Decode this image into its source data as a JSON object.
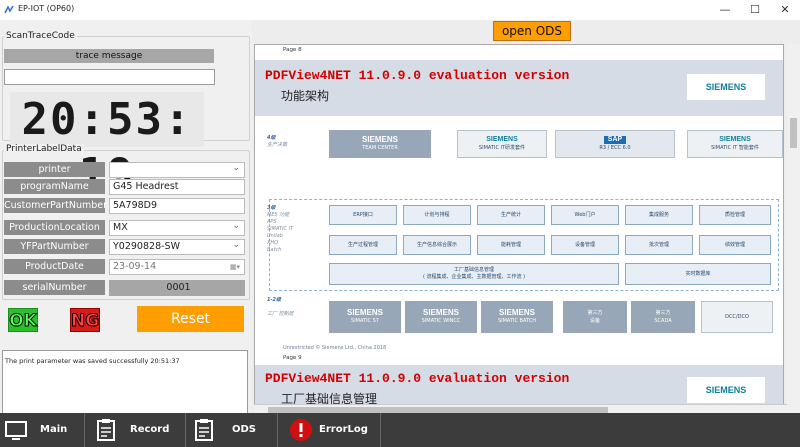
{
  "window": {
    "title": "EP-IOT (OP60)",
    "min": "—",
    "max": "☐",
    "close": "✕"
  },
  "left": {
    "scan_title": "ScanTraceCode",
    "trace_label": "trace message",
    "trace_value": "",
    "clock": "20:53: 19",
    "printer_title": "PrinterLabelData",
    "fields": [
      {
        "label": "printer",
        "value": ""
      },
      {
        "label": "programName",
        "value": "G45 Headrest"
      },
      {
        "label": "CustomerPartNumber",
        "value": "5A798D9"
      },
      {
        "label": "ProductionLocation",
        "value": "MX"
      },
      {
        "label": "YFPartNumber",
        "value": "Y0290828-SW"
      },
      {
        "label": "ProductDate",
        "value": "23-09-14"
      }
    ],
    "serial_label": "serialNumber",
    "serial_value": "0001",
    "ok": "OK",
    "ng": "NG",
    "reset": "Reset",
    "log": "The print parameter was saved successfully  20:51:37"
  },
  "right": {
    "open_ods": "open ODS",
    "pdf": {
      "page8": "Page 8",
      "page9": "Page 9",
      "eval": "PDFView4NET 11.0.9.0 evaluation version",
      "title1": "功能架构",
      "title2": "工厂基础信息管理",
      "logo": "SIEMENS",
      "copyright": "Unrestricted © Siemens Ltd., China 2018",
      "levels": {
        "l4": "4级",
        "l4s": "生产决策",
        "l3": "3级",
        "l3s": "MES 功能",
        "l3list": "APS\nSIMATIC IT\nUnilab\nXHQ\nBatch",
        "l12": "1-2级",
        "l12s": "工厂 控制层"
      },
      "row4": [
        {
          "b": "SIEMENS",
          "t": "TEAM CENTER"
        },
        {
          "b": "SIEMENS",
          "t": "SIMATIC IT研发套件"
        },
        {
          "b": "SAP",
          "t": "R3 / ECC 6.0"
        },
        {
          "b": "SIEMENS",
          "t": "SIMATIC IT 智能套件"
        }
      ],
      "row3a": [
        "ERP接口",
        "计划与排程",
        "生产统计",
        "Web门户",
        "集成服务",
        "质检管理"
      ],
      "row3b": [
        "生产过程管理",
        "生产信息综合展示",
        "能耗管理",
        "设备管理",
        "批次管理",
        "绩效管理"
      ],
      "row3c": {
        "t": "工厂基础信息管理",
        "s": "( 流程集成、企业集成、主数据管理、工作流 )",
        "rt": "实时数据库"
      },
      "row12": [
        {
          "b": "SIEMENS",
          "t": "SIMATIC S7"
        },
        {
          "b": "SIEMENS",
          "t": "SIMATIC WINCC"
        },
        {
          "b": "SIEMENS",
          "t": "SIMATIC BATCH"
        },
        {
          "b": "第三方",
          "t": "设备"
        },
        {
          "b": "第三方",
          "t": "SCADA"
        },
        {
          "b": "",
          "t": "DCC/DCO"
        }
      ]
    }
  },
  "taskbar": [
    "Main",
    "Record",
    "ODS",
    "ErrorLog"
  ]
}
